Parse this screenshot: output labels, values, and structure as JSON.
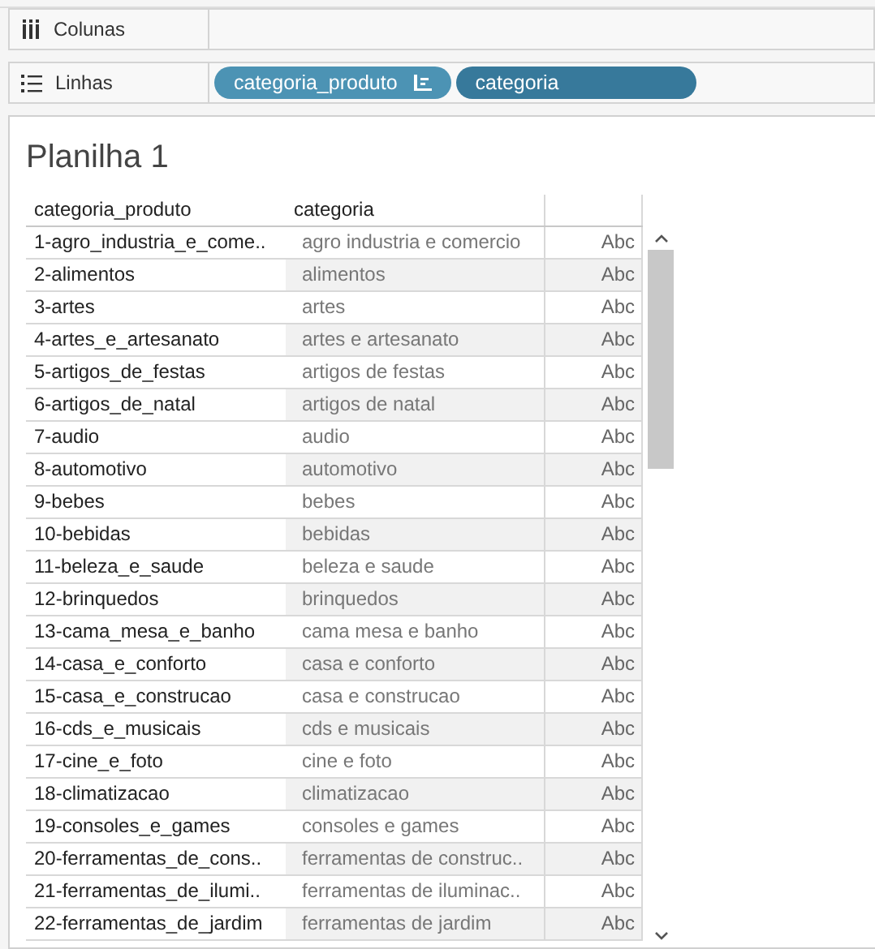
{
  "shelves": [
    {
      "kind": "columns",
      "label": "Colunas"
    },
    {
      "kind": "rows",
      "label": "Linhas",
      "pills": [
        {
          "label": "categoria_produto",
          "color": "#4c93b4",
          "sorted": true
        },
        {
          "label": "categoria",
          "color": "#37799b",
          "sorted": false
        }
      ]
    }
  ],
  "sheet": {
    "title": "Planilha 1"
  },
  "table": {
    "columns": [
      "categoria_produto",
      "categoria"
    ],
    "rows": [
      [
        "1-agro_industria_e_come..",
        "agro industria e comercio",
        "Abc"
      ],
      [
        "2-alimentos",
        "alimentos",
        "Abc"
      ],
      [
        "3-artes",
        "artes",
        "Abc"
      ],
      [
        "4-artes_e_artesanato",
        "artes e artesanato",
        "Abc"
      ],
      [
        "5-artigos_de_festas",
        "artigos de festas",
        "Abc"
      ],
      [
        "6-artigos_de_natal",
        "artigos de natal",
        "Abc"
      ],
      [
        "7-audio",
        "audio",
        "Abc"
      ],
      [
        "8-automotivo",
        "automotivo",
        "Abc"
      ],
      [
        "9-bebes",
        "bebes",
        "Abc"
      ],
      [
        "10-bebidas",
        "bebidas",
        "Abc"
      ],
      [
        "11-beleza_e_saude",
        "beleza e saude",
        "Abc"
      ],
      [
        "12-brinquedos",
        "brinquedos",
        "Abc"
      ],
      [
        "13-cama_mesa_e_banho",
        "cama mesa e banho",
        "Abc"
      ],
      [
        "14-casa_e_conforto",
        "casa e conforto",
        "Abc"
      ],
      [
        "15-casa_e_construcao",
        "casa e construcao",
        "Abc"
      ],
      [
        "16-cds_e_musicais",
        "cds e musicais",
        "Abc"
      ],
      [
        "17-cine_e_foto",
        "cine e foto",
        "Abc"
      ],
      [
        "18-climatizacao",
        "climatizacao",
        "Abc"
      ],
      [
        "19-consoles_e_games",
        "consoles e games",
        "Abc"
      ],
      [
        "20-ferramentas_de_cons..",
        "ferramentas de construc..",
        "Abc"
      ],
      [
        "21-ferramentas_de_ilumi..",
        "ferramentas de iluminac..",
        "Abc"
      ],
      [
        "22-ferramentas_de_jardim",
        "ferramentas de jardim",
        "Abc"
      ]
    ]
  }
}
